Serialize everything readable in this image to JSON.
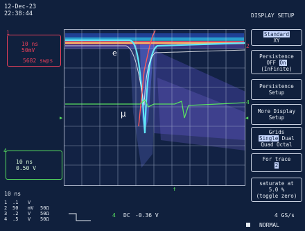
{
  "header": {
    "date": "12-Dec-23",
    "time": "22:38:44"
  },
  "ch_red": {
    "number": "1",
    "timebase": "10 ns",
    "volts": "50mV",
    "sweeps": "5682 swps",
    "color": "#e8405a"
  },
  "ch_green": {
    "number": "4",
    "timebase": "10 ns",
    "volts": "0.50 V",
    "color": "#58e060"
  },
  "footer": {
    "timebase": "10 ns",
    "channels": [
      {
        "n": "1",
        "v": ".1",
        "u": "V",
        "imp": ""
      },
      {
        "n": "2",
        "v": "50",
        "u": "mV",
        "imp": "50Ω"
      },
      {
        "n": "3",
        "v": ".2",
        "u": "V",
        "imp": "50Ω"
      },
      {
        "n": "4",
        "v": ".5",
        "u": "V",
        "imp": "50Ω"
      }
    ],
    "trigger_channel": "4",
    "trigger_coupling": "DC",
    "trigger_level": "-0.36 V",
    "sample_rate": "4 GS/s",
    "mode": "NORMAL"
  },
  "waveform_labels": {
    "electron": "e",
    "muon": "μ"
  },
  "menu": {
    "title": "DISPLAY SETUP",
    "display_mode": {
      "option1": "Standard",
      "option2": "XY"
    },
    "persistence": {
      "title": "Persistence",
      "off": "OFF",
      "on": "On",
      "mode": "(InFinite)"
    },
    "persistence_setup": {
      "line1": "Persistence",
      "line2": "Setup"
    },
    "more_display": {
      "line1": "More Display",
      "line2": "Setup"
    },
    "grids": {
      "title": "Grids",
      "single": "Single",
      "dual": "Dual",
      "quad": "Quad",
      "octal": "Octal"
    },
    "for_trace": {
      "title": "For trace",
      "value": "2"
    },
    "saturate": {
      "line1": "saturate at",
      "line2": "5.0 %",
      "line3": "(toggle zero)"
    }
  }
}
